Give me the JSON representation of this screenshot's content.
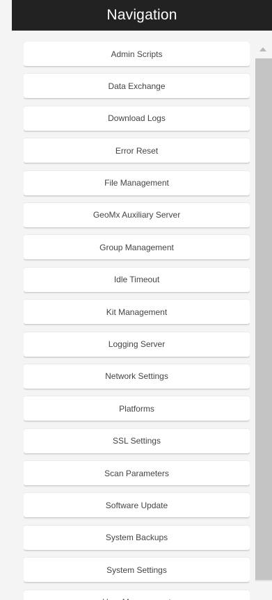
{
  "header": {
    "title": "Navigation"
  },
  "items": [
    {
      "label": "Admin Scripts"
    },
    {
      "label": "Data Exchange"
    },
    {
      "label": "Download Logs"
    },
    {
      "label": "Error Reset"
    },
    {
      "label": "File Management"
    },
    {
      "label": "GeoMx Auxiliary Server"
    },
    {
      "label": "Group Management"
    },
    {
      "label": "Idle Timeout"
    },
    {
      "label": "Kit Management"
    },
    {
      "label": "Logging Server"
    },
    {
      "label": "Network Settings"
    },
    {
      "label": "Platforms"
    },
    {
      "label": "SSL Settings"
    },
    {
      "label": "Scan Parameters"
    },
    {
      "label": "Software Update"
    },
    {
      "label": "System Backups"
    },
    {
      "label": "System Settings"
    },
    {
      "label": "User Management"
    }
  ],
  "icons": {
    "scroll_up": "chevron-up-icon"
  },
  "colors": {
    "header_bg": "#222222",
    "panel_bg": "#f4f4f4",
    "button_bg": "#ffffff",
    "text": "#444444"
  }
}
